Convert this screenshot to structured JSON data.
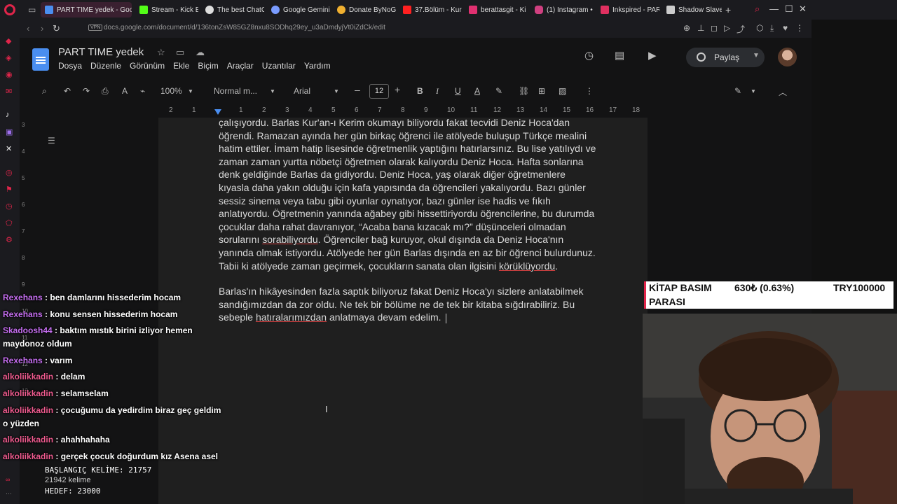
{
  "browser": {
    "tabs": [
      {
        "label": "PART TIME yedek - Goog",
        "active": true,
        "color": "#4a8ef0"
      },
      {
        "label": "Stream - Kick E",
        "color": "#53fc18"
      },
      {
        "label": "The best ChatG",
        "color": "#dddddd"
      },
      {
        "label": "Google Gemini",
        "color": "#7a9cff"
      },
      {
        "label": "Donate ByNoG",
        "color": "#f0b030"
      },
      {
        "label": "37.Bölüm - Kur",
        "color": "#ff2020"
      },
      {
        "label": "berattasgit - Ki",
        "color": "#e03070"
      },
      {
        "label": "(1) Instagram •",
        "color": "#d04080"
      },
      {
        "label": "Inkspired - PAR",
        "color": "#e03060"
      },
      {
        "label": "Shadow Slave",
        "color": "#cccccc"
      }
    ],
    "new_tab": "+",
    "vpn_label": "VPN",
    "url": "docs.google.com/document/d/136tonZsW85GZ8nxu8SODhq29ey_u3aDmdyjVt0iZdCk/edit",
    "accent": "#e0254a"
  },
  "doc": {
    "title": "PART TIME  yedek",
    "menu": [
      "Dosya",
      "Düzenle",
      "Görünüm",
      "Ekle",
      "Biçim",
      "Araçlar",
      "Uzantılar",
      "Yardım"
    ],
    "share_label": "Paylaş",
    "zoom": "100%",
    "style": "Normal m...",
    "font": "Arial",
    "font_size": "12",
    "ruler_numbers": [
      "2",
      "1",
      "1",
      "2",
      "3",
      "4",
      "5",
      "6",
      "7",
      "8",
      "9",
      "10",
      "11",
      "12",
      "13",
      "14",
      "15",
      "16",
      "17",
      "18"
    ],
    "vruler_numbers": [
      "3",
      "4",
      "5",
      "6",
      "7",
      "8",
      "9",
      "10",
      "11",
      "12",
      "13"
    ],
    "paragraph1": "çalışıyordu. Barlas Kur'an-ı Kerim okumayı biliyordu fakat tecvidi Deniz Hoca'dan öğrendi. Ramazan ayında her gün birkaç öğrenci ile atölyede buluşup Türkçe mealini hatim ettiler. İmam hatip lisesinde öğretmenlik yaptığını hatırlarsınız. Bu lise yatılıydı ve zaman zaman yurtta nöbetçi öğretmen olarak kalıyordu Deniz Hoca. Hafta sonlarına denk geldiğinde Barlas da gidiyordu. Deniz Hoca, yaş olarak diğer öğretmenlere kıyasla daha yakın olduğu için kafa yapısında da öğrencileri yakalıyordu. Bazı günler sessiz sinema veya tabu gibi oyunlar oynatıyor, bazı günler ise hadis ve fıkıh anlatıyordu. Öğretmenin yanında ağabey gibi hissettiriyordu öğrencilerine, bu durumda çocuklar daha rahat davranıyor, “Acaba bana kızacak mı?” düşünceleri olmadan sorularını ",
    "p1_spell1": "sorabiliyordu",
    "p1_mid": ". Öğrenciler bağ kuruyor, okul dışında da Deniz Hoca'nın yanında olmak istiyordu. Atölyede her gün Barlas dışında en az bir öğrenci bulurdunuz. Tabii ki atölyede zaman geçirmek, çocukların sanata olan ilgisini ",
    "p1_spell2": "körüklüyordu",
    "p1_end": ".",
    "paragraph2": "Barlas'ın hikâyesinden fazla saptık biliyoruz fakat Deniz Hoca'yı sizlere anlatabilmek sandığımızdan da zor oldu. Ne tek bir bölüme ne de tek bir kitaba sığdırabiliriz. Bu sebeple ",
    "p2_spell": "hatıralarımızdan",
    "p2_end": " anlatmaya devam edelim."
  },
  "chat": {
    "messages": [
      {
        "user": "Rexehans",
        "text": "ben damlarını hissederim hocam",
        "pink": false
      },
      {
        "user": "Rexehans",
        "text": "konu sensen hissederim hocam",
        "pink": false
      },
      {
        "user": "Skadoosh44",
        "text": "baktım mıstık birini izliyor hemen maydonoz oldum",
        "pink": false
      },
      {
        "user": "Rexehans",
        "text": "varım",
        "pink": false
      },
      {
        "user": "alkoliikkadin",
        "text": "delam",
        "pink": true
      },
      {
        "user": "alkoliikkadin",
        "text": "selamselam",
        "pink": true
      },
      {
        "user": "alkoliikkadin",
        "text": "çocuğumu da yedirdim biraz geç geldim o yüzden",
        "pink": true
      },
      {
        "user": "alkoliikkadin",
        "text": "ahahhahaha",
        "pink": true
      },
      {
        "user": "alkoliikkadin",
        "text": "gerçek çocuk doğurdum kız Asena asel",
        "pink": true
      }
    ]
  },
  "overlay": {
    "start_words": "BAŞLANGIÇ KELİME: 21757",
    "word_count": "21942 kelime",
    "target": "HEDEF: 23000",
    "ticker_label1": "KİTAP BASIM",
    "ticker_label2": "PARASI",
    "ticker_value": "630₺ (0.63%)",
    "ticker_goal": "TRY100000"
  }
}
